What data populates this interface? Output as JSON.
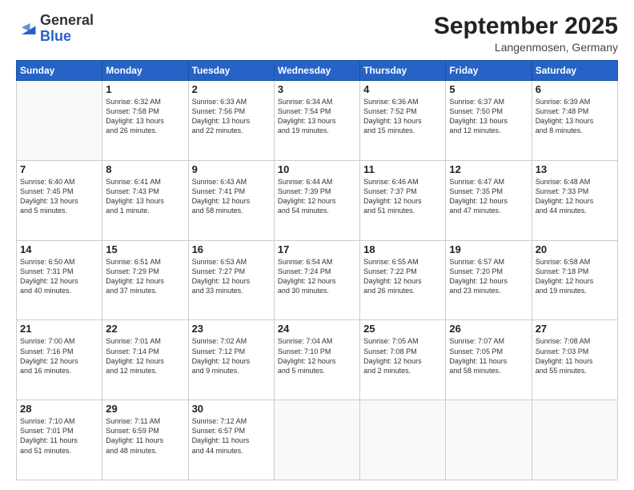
{
  "header": {
    "logo_general": "General",
    "logo_blue": "Blue",
    "month": "September 2025",
    "location": "Langenmosen, Germany"
  },
  "weekdays": [
    "Sunday",
    "Monday",
    "Tuesday",
    "Wednesday",
    "Thursday",
    "Friday",
    "Saturday"
  ],
  "weeks": [
    [
      {
        "day": "",
        "info": ""
      },
      {
        "day": "1",
        "info": "Sunrise: 6:32 AM\nSunset: 7:58 PM\nDaylight: 13 hours\nand 26 minutes."
      },
      {
        "day": "2",
        "info": "Sunrise: 6:33 AM\nSunset: 7:56 PM\nDaylight: 13 hours\nand 22 minutes."
      },
      {
        "day": "3",
        "info": "Sunrise: 6:34 AM\nSunset: 7:54 PM\nDaylight: 13 hours\nand 19 minutes."
      },
      {
        "day": "4",
        "info": "Sunrise: 6:36 AM\nSunset: 7:52 PM\nDaylight: 13 hours\nand 15 minutes."
      },
      {
        "day": "5",
        "info": "Sunrise: 6:37 AM\nSunset: 7:50 PM\nDaylight: 13 hours\nand 12 minutes."
      },
      {
        "day": "6",
        "info": "Sunrise: 6:39 AM\nSunset: 7:48 PM\nDaylight: 13 hours\nand 8 minutes."
      }
    ],
    [
      {
        "day": "7",
        "info": "Sunrise: 6:40 AM\nSunset: 7:45 PM\nDaylight: 13 hours\nand 5 minutes."
      },
      {
        "day": "8",
        "info": "Sunrise: 6:41 AM\nSunset: 7:43 PM\nDaylight: 13 hours\nand 1 minute."
      },
      {
        "day": "9",
        "info": "Sunrise: 6:43 AM\nSunset: 7:41 PM\nDaylight: 12 hours\nand 58 minutes."
      },
      {
        "day": "10",
        "info": "Sunrise: 6:44 AM\nSunset: 7:39 PM\nDaylight: 12 hours\nand 54 minutes."
      },
      {
        "day": "11",
        "info": "Sunrise: 6:46 AM\nSunset: 7:37 PM\nDaylight: 12 hours\nand 51 minutes."
      },
      {
        "day": "12",
        "info": "Sunrise: 6:47 AM\nSunset: 7:35 PM\nDaylight: 12 hours\nand 47 minutes."
      },
      {
        "day": "13",
        "info": "Sunrise: 6:48 AM\nSunset: 7:33 PM\nDaylight: 12 hours\nand 44 minutes."
      }
    ],
    [
      {
        "day": "14",
        "info": "Sunrise: 6:50 AM\nSunset: 7:31 PM\nDaylight: 12 hours\nand 40 minutes."
      },
      {
        "day": "15",
        "info": "Sunrise: 6:51 AM\nSunset: 7:29 PM\nDaylight: 12 hours\nand 37 minutes."
      },
      {
        "day": "16",
        "info": "Sunrise: 6:53 AM\nSunset: 7:27 PM\nDaylight: 12 hours\nand 33 minutes."
      },
      {
        "day": "17",
        "info": "Sunrise: 6:54 AM\nSunset: 7:24 PM\nDaylight: 12 hours\nand 30 minutes."
      },
      {
        "day": "18",
        "info": "Sunrise: 6:55 AM\nSunset: 7:22 PM\nDaylight: 12 hours\nand 26 minutes."
      },
      {
        "day": "19",
        "info": "Sunrise: 6:57 AM\nSunset: 7:20 PM\nDaylight: 12 hours\nand 23 minutes."
      },
      {
        "day": "20",
        "info": "Sunrise: 6:58 AM\nSunset: 7:18 PM\nDaylight: 12 hours\nand 19 minutes."
      }
    ],
    [
      {
        "day": "21",
        "info": "Sunrise: 7:00 AM\nSunset: 7:16 PM\nDaylight: 12 hours\nand 16 minutes."
      },
      {
        "day": "22",
        "info": "Sunrise: 7:01 AM\nSunset: 7:14 PM\nDaylight: 12 hours\nand 12 minutes."
      },
      {
        "day": "23",
        "info": "Sunrise: 7:02 AM\nSunset: 7:12 PM\nDaylight: 12 hours\nand 9 minutes."
      },
      {
        "day": "24",
        "info": "Sunrise: 7:04 AM\nSunset: 7:10 PM\nDaylight: 12 hours\nand 5 minutes."
      },
      {
        "day": "25",
        "info": "Sunrise: 7:05 AM\nSunset: 7:08 PM\nDaylight: 12 hours\nand 2 minutes."
      },
      {
        "day": "26",
        "info": "Sunrise: 7:07 AM\nSunset: 7:05 PM\nDaylight: 11 hours\nand 58 minutes."
      },
      {
        "day": "27",
        "info": "Sunrise: 7:08 AM\nSunset: 7:03 PM\nDaylight: 11 hours\nand 55 minutes."
      }
    ],
    [
      {
        "day": "28",
        "info": "Sunrise: 7:10 AM\nSunset: 7:01 PM\nDaylight: 11 hours\nand 51 minutes."
      },
      {
        "day": "29",
        "info": "Sunrise: 7:11 AM\nSunset: 6:59 PM\nDaylight: 11 hours\nand 48 minutes."
      },
      {
        "day": "30",
        "info": "Sunrise: 7:12 AM\nSunset: 6:57 PM\nDaylight: 11 hours\nand 44 minutes."
      },
      {
        "day": "",
        "info": ""
      },
      {
        "day": "",
        "info": ""
      },
      {
        "day": "",
        "info": ""
      },
      {
        "day": "",
        "info": ""
      }
    ]
  ]
}
